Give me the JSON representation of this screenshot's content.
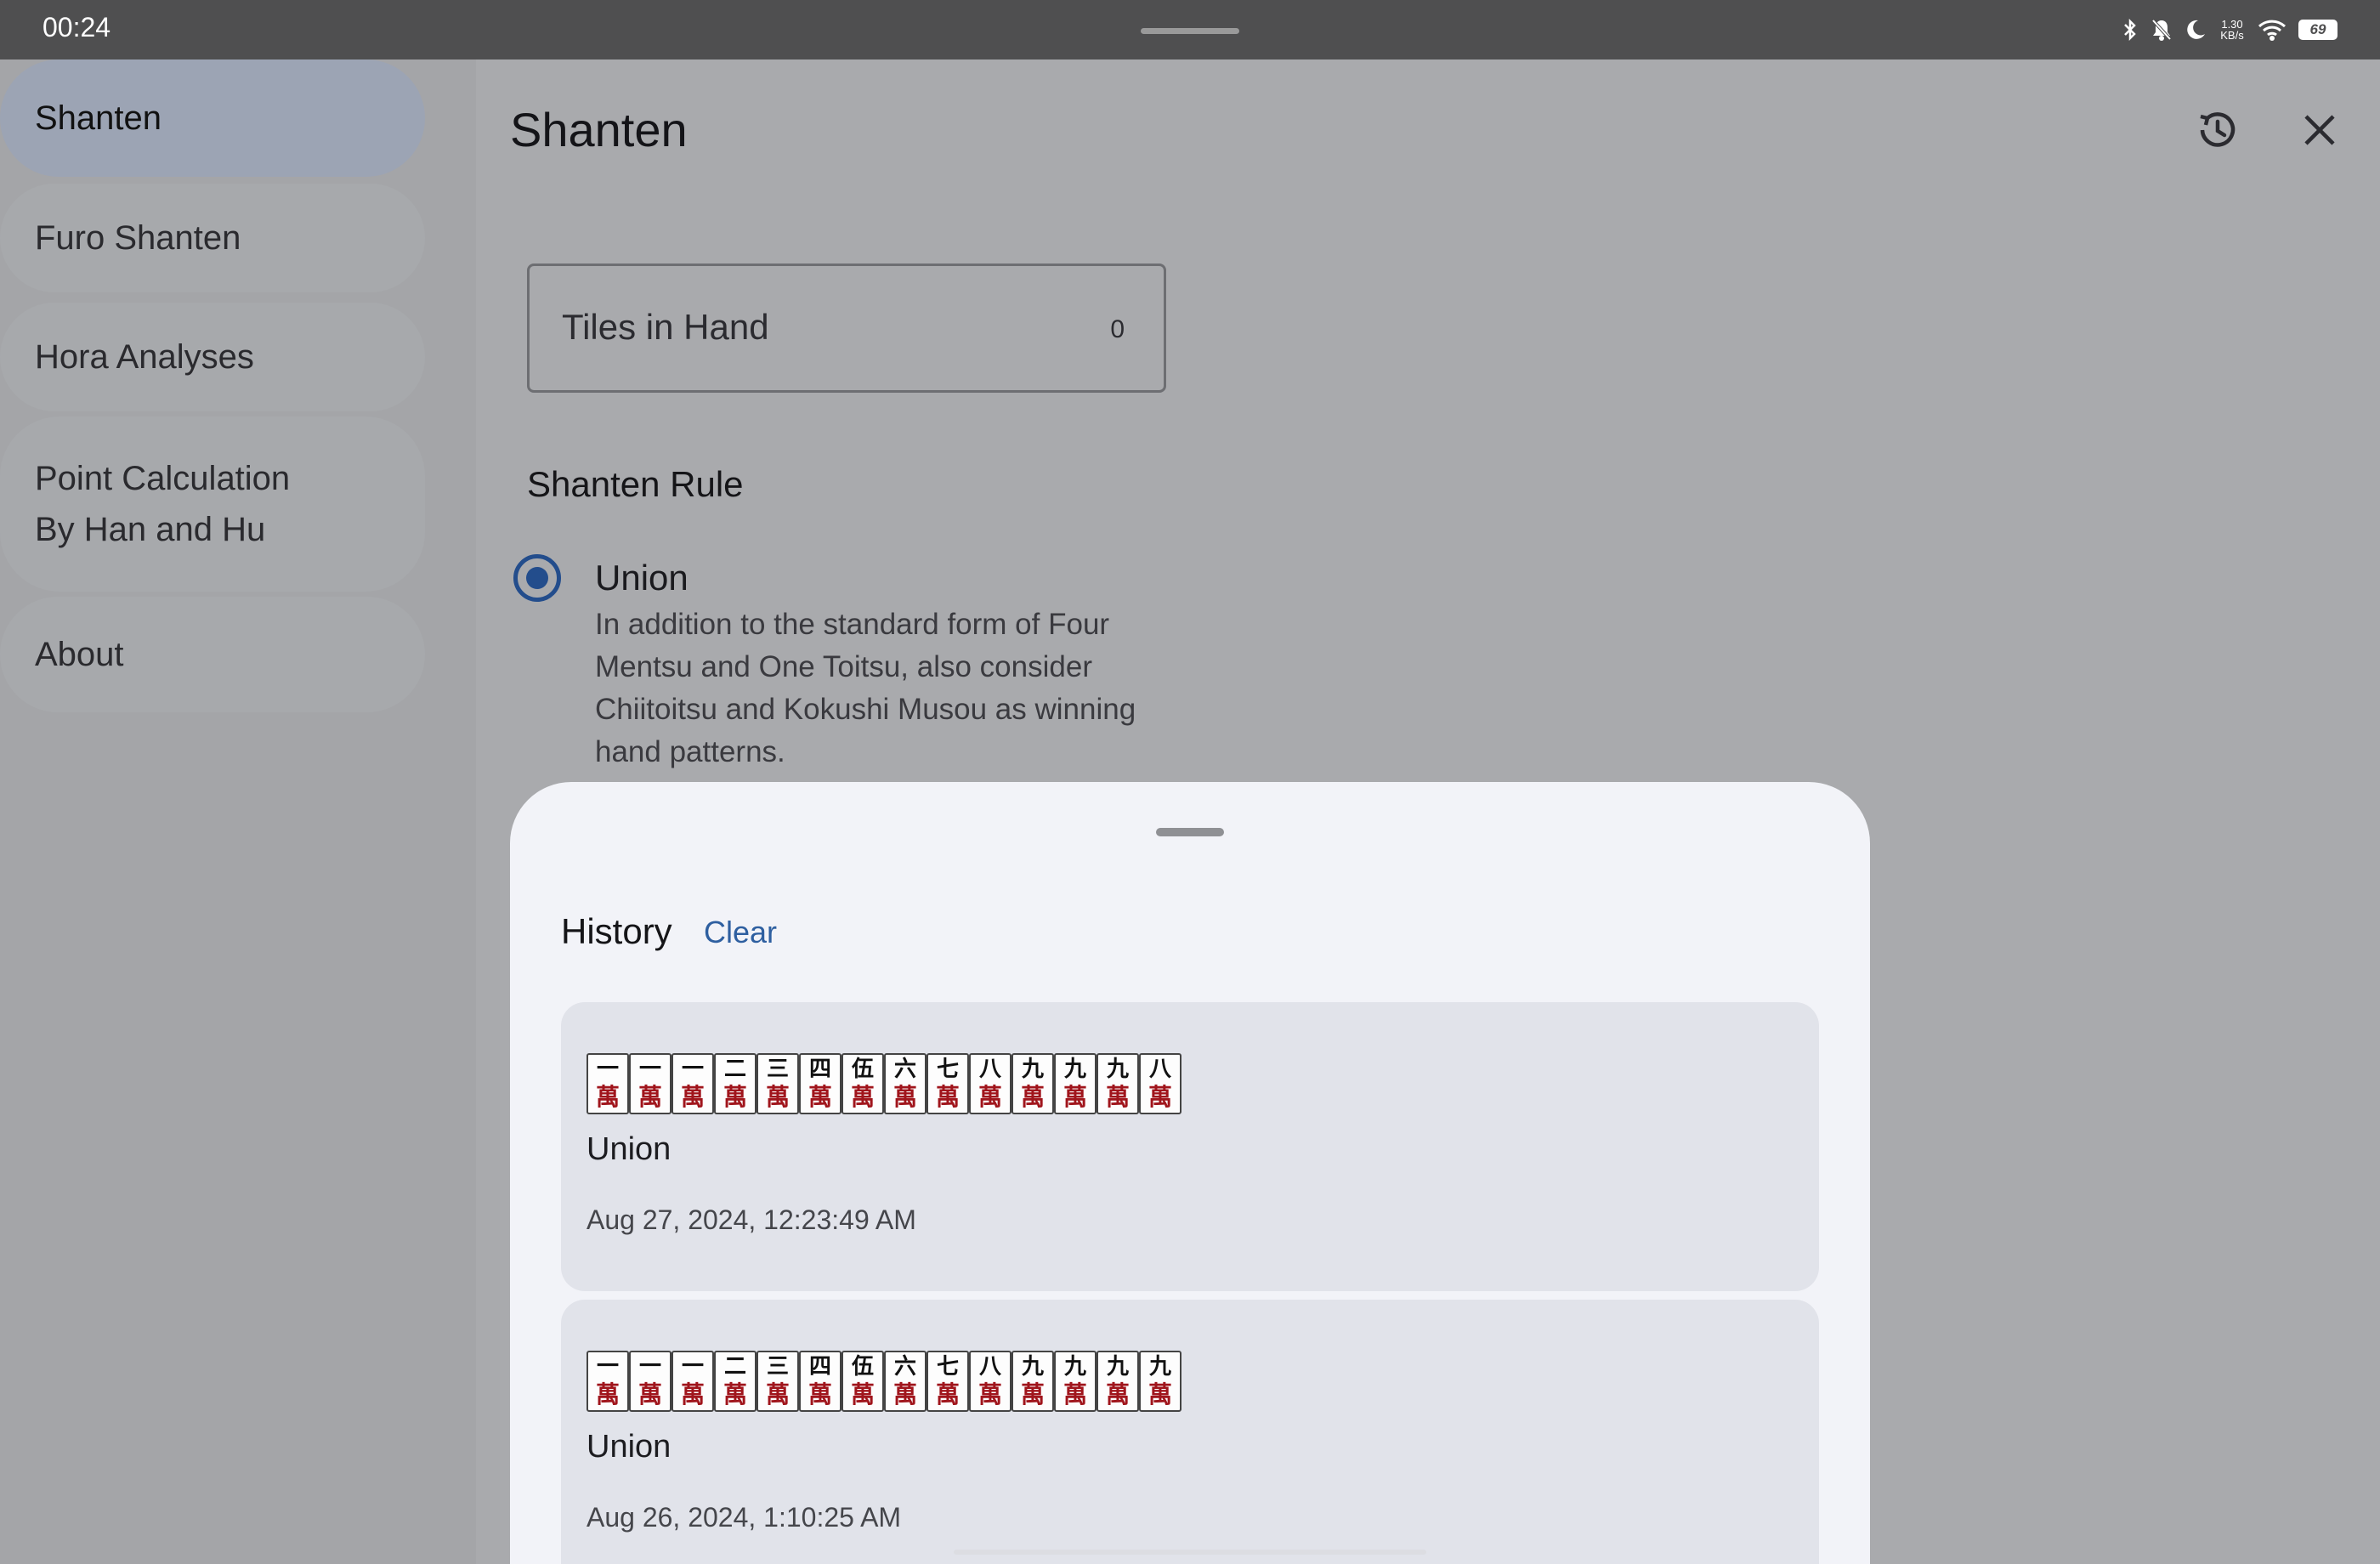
{
  "status_bar": {
    "time": "00:24",
    "net_speed_top": "1.30",
    "net_speed_bottom": "KB/s",
    "battery": "69",
    "icons": [
      "bluetooth-icon",
      "mute-icon",
      "moon-icon",
      "wifi-icon",
      "battery-icon"
    ]
  },
  "sidebar": {
    "items": [
      {
        "label": "Shanten",
        "active": true
      },
      {
        "label": "Furo Shanten",
        "active": false
      },
      {
        "label": "Hora Analyses",
        "active": false
      },
      {
        "label_line1": "Point Calculation",
        "label_line2": "By Han and Hu",
        "active": false
      },
      {
        "label": "About",
        "active": false
      }
    ]
  },
  "main": {
    "title": "Shanten",
    "header_icons": [
      "history-icon",
      "close-icon"
    ],
    "tiles_field": {
      "label": "Tiles in Hand",
      "count": "0"
    },
    "rule_section_title": "Shanten Rule",
    "selected_rule": {
      "label": "Union",
      "description": "In addition to the standard form of Four Mentsu and One Toitsu, also consider Chiitoitsu and Kokushi Musou as winning hand patterns."
    }
  },
  "history": {
    "title": "History",
    "clear_label": "Clear",
    "entries": [
      {
        "tiles": [
          "一",
          "一",
          "一",
          "二",
          "三",
          "四",
          "伍",
          "六",
          "七",
          "八",
          "九",
          "九",
          "九",
          "八"
        ],
        "rule": "Union",
        "date": "Aug 27, 2024, 12:23:49 AM"
      },
      {
        "tiles": [
          "一",
          "一",
          "一",
          "二",
          "三",
          "四",
          "伍",
          "六",
          "七",
          "八",
          "九",
          "九",
          "九",
          "九"
        ],
        "rule": "Union",
        "date": "Aug 26, 2024, 1:10:25 AM"
      }
    ],
    "tile_suit": "萬"
  },
  "colors": {
    "accent": "#234d8c",
    "link": "#2e5fa0",
    "man_red": "#a0151c",
    "scrim": "#a9aaad",
    "sheet": "#f2f3f8"
  }
}
